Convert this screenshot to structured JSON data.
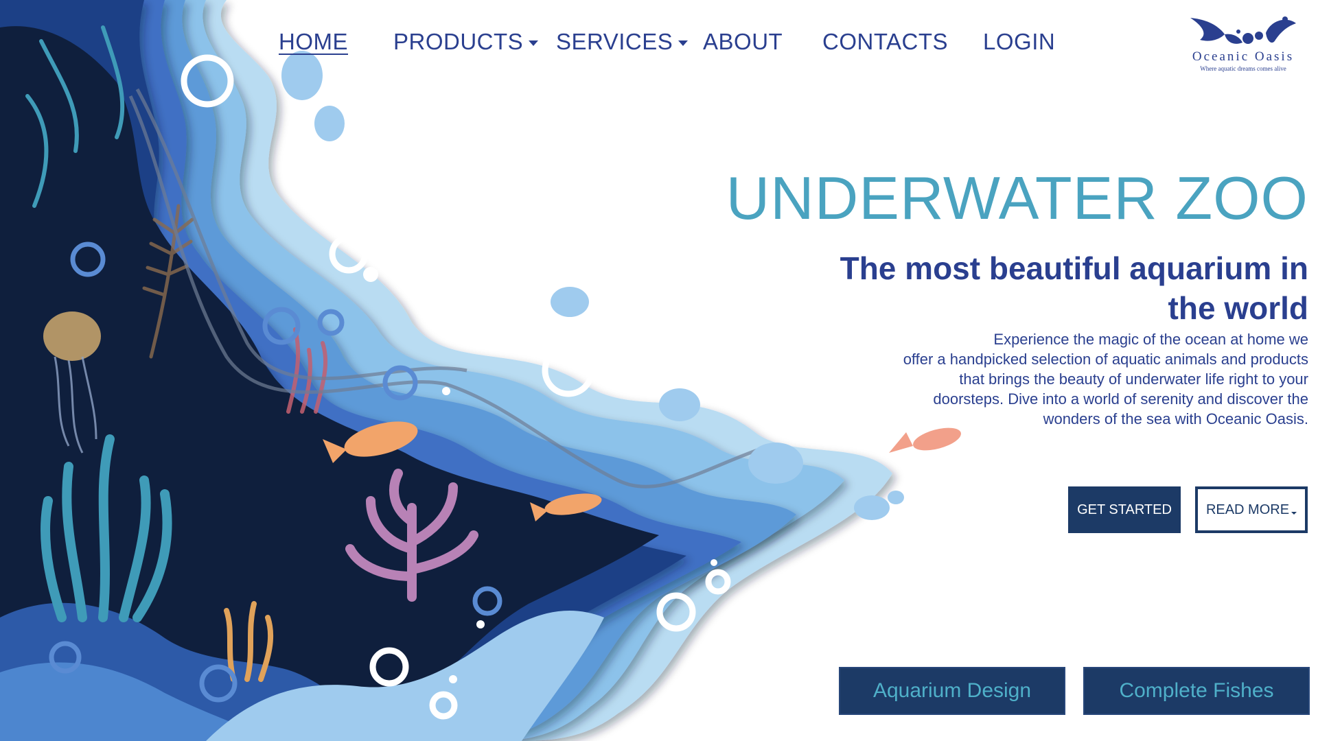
{
  "nav": {
    "items": [
      {
        "label": "HOME",
        "active": true,
        "dropdown": false
      },
      {
        "label": "PRODUCTS",
        "active": false,
        "dropdown": true
      },
      {
        "label": "SERVICES",
        "active": false,
        "dropdown": true
      },
      {
        "label": "ABOUT",
        "active": false,
        "dropdown": false
      },
      {
        "label": "CONTACTS",
        "active": false,
        "dropdown": false
      },
      {
        "label": "LOGIN",
        "active": false,
        "dropdown": false
      }
    ]
  },
  "logo": {
    "name": "Oceanic Oasis",
    "tagline": "Where aquatic dreams comes alive"
  },
  "hero": {
    "title": "UNDERWATER ZOO",
    "subtitle": "The most beautiful aquarium in the world",
    "description": "Experience the magic of the ocean at home we\noffer a handpicked selection of aquatic animals and products\nthat brings the beauty  of underwater life right to your\ndoorsteps. Dive into a world of serenity and discover  the\nwonders of the sea with Oceanic Oasis."
  },
  "buttons": {
    "get_started": "GET STARTED",
    "read_more": "READ MORE"
  },
  "tiles": {
    "aquarium_design": "Aquarium Design",
    "complete_fishes": "Complete Fishes"
  },
  "colors": {
    "navy": "#1c3a66",
    "nav_text": "#2a3f8f",
    "title_teal": "#4aa3c0",
    "deep_water": "#0f1f3d",
    "light_water": "#a9d2ee"
  }
}
